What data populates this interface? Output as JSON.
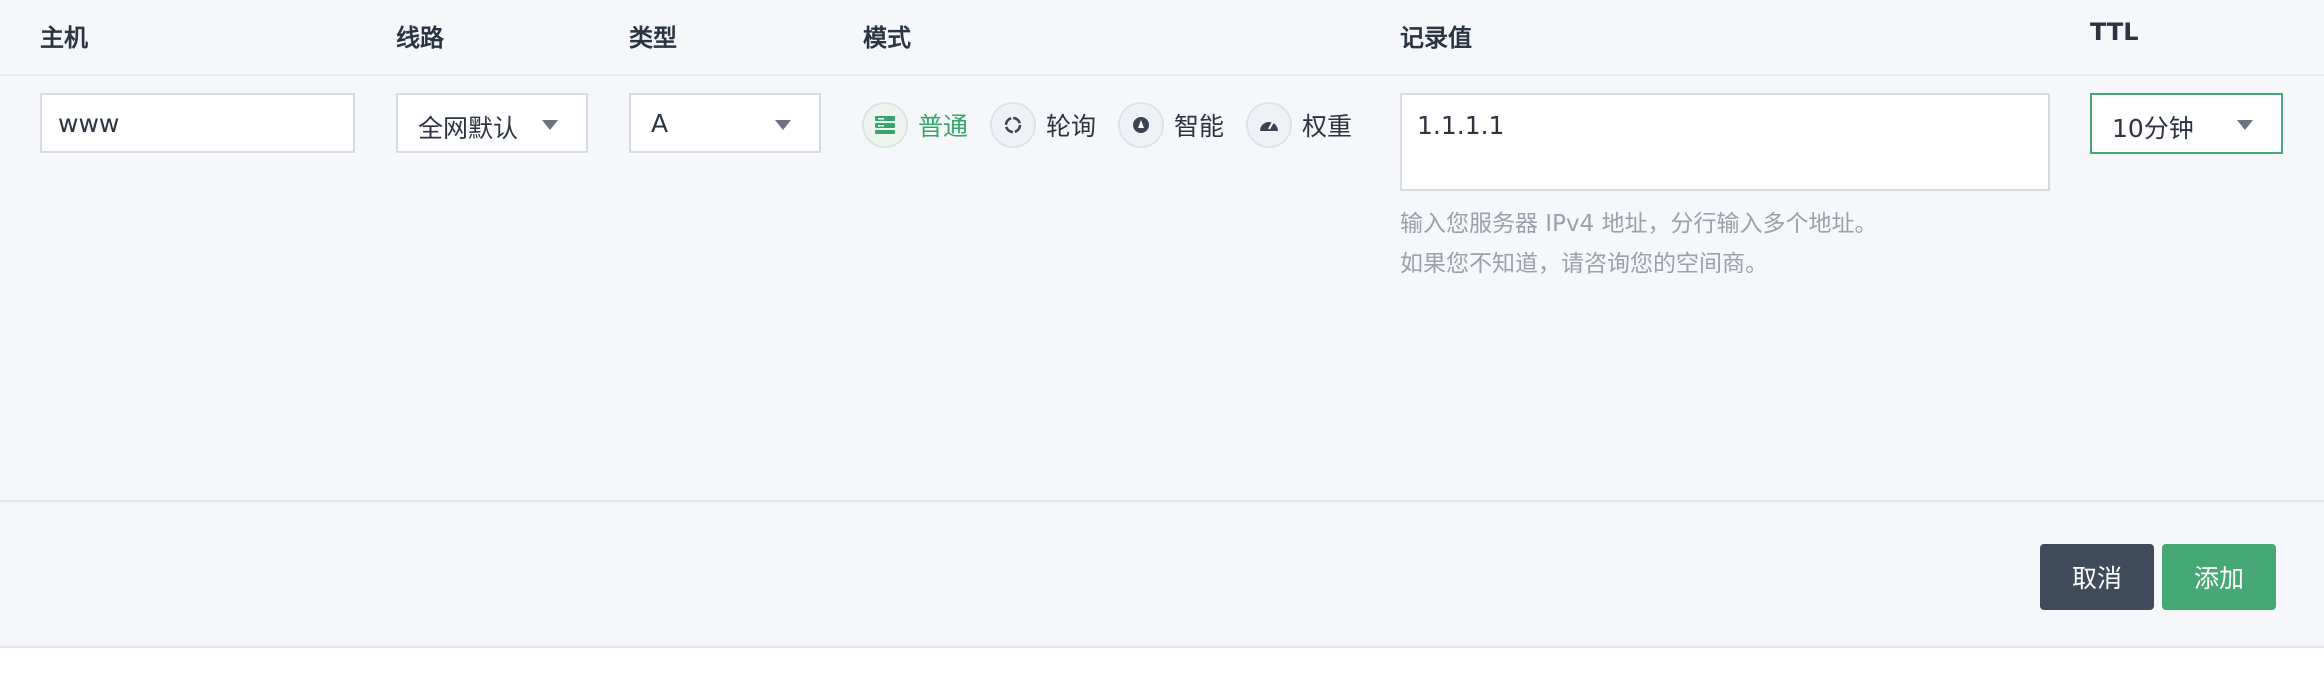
{
  "headers": {
    "host": "主机",
    "line": "线路",
    "type": "类型",
    "mode": "模式",
    "value": "记录值",
    "ttl": "TTL"
  },
  "fields": {
    "host_value": "www",
    "line_value": "全网默认",
    "type_value": "A",
    "record_value": "1.1.1.1",
    "ttl_value": "10分钟"
  },
  "modes": [
    {
      "label": "普通",
      "icon": "server-icon",
      "active": true
    },
    {
      "label": "轮询",
      "icon": "cycle-icon",
      "active": false
    },
    {
      "label": "智能",
      "icon": "smart-gear-icon",
      "active": false
    },
    {
      "label": "权重",
      "icon": "gauge-icon",
      "active": false
    }
  ],
  "help": {
    "line1": "输入您服务器 IPv4 地址，分行输入多个地址。",
    "line2": "如果您不知道，请咨询您的空间商。"
  },
  "buttons": {
    "cancel": "取消",
    "add": "添加"
  },
  "colors": {
    "accent_green": "#46a874",
    "cancel_dark": "#3f4b5a",
    "ttl_border": "#46a874"
  }
}
